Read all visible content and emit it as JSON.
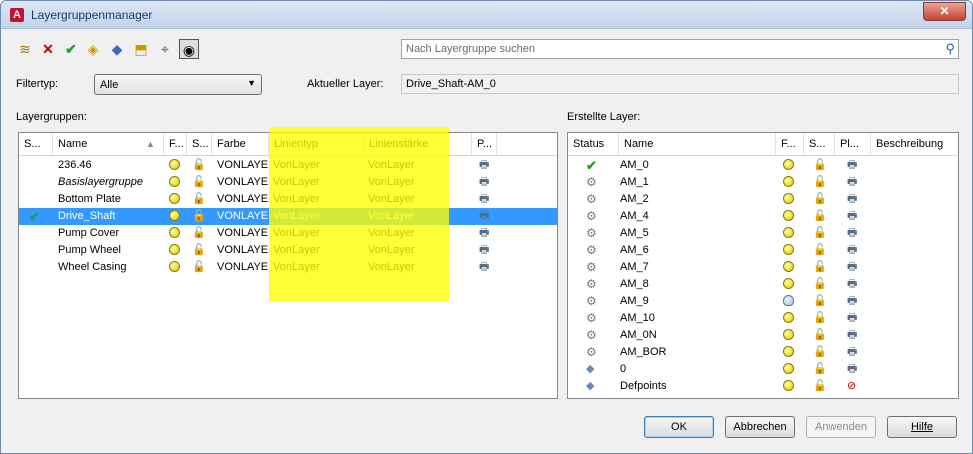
{
  "window": {
    "title": "Layergruppenmanager",
    "close": "✕",
    "app_icon": "A"
  },
  "toolbar": {
    "icons": [
      "new-group-icon",
      "delete-icon",
      "set-current-icon",
      "add-layer-icon",
      "remove-layer-icon",
      "select-object-icon",
      "isolate-icon",
      "visibility-eye-icon"
    ]
  },
  "search": {
    "placeholder": "Nach Layergruppe suchen"
  },
  "filter": {
    "label": "Filtertyp:",
    "value": "Alle"
  },
  "current_layer": {
    "label": "Aktueller Layer:",
    "value": "Drive_Shaft-AM_0"
  },
  "groups_panel": {
    "label": "Layergruppen:",
    "columns": [
      "S...",
      "Name",
      "F...",
      "S...",
      "Farbe",
      "Linientyp",
      "Linienstärke",
      "P..."
    ],
    "rows": [
      {
        "name": "236.46",
        "color": "VONLAYER",
        "linetype": "VonLayer",
        "lineweight": "VonLayer",
        "current": false,
        "italic": false
      },
      {
        "name": "Basislayergruppe",
        "color": "VONLAYER",
        "linetype": "VonLayer",
        "lineweight": "VonLayer",
        "current": false,
        "italic": true
      },
      {
        "name": "Bottom Plate",
        "color": "VONLAYER",
        "linetype": "VonLayer",
        "lineweight": "VonLayer",
        "current": false,
        "italic": false
      },
      {
        "name": "Drive_Shaft",
        "color": "VONLAYER",
        "linetype": "VonLayer",
        "lineweight": "VonLayer",
        "current": true,
        "italic": false
      },
      {
        "name": "Pump Cover",
        "color": "VONLAYER",
        "linetype": "VonLayer",
        "lineweight": "VonLayer",
        "current": false,
        "italic": false
      },
      {
        "name": "Pump Wheel",
        "color": "VONLAYER",
        "linetype": "VonLayer",
        "lineweight": "VonLayer",
        "current": false,
        "italic": false
      },
      {
        "name": "Wheel Casing",
        "color": "VONLAYER",
        "linetype": "VonLayer",
        "lineweight": "VonLayer",
        "current": false,
        "italic": false
      }
    ]
  },
  "layers_panel": {
    "label": "Erstellte Layer:",
    "columns": [
      "Status",
      "Name",
      "F...",
      "S...",
      "Pl...",
      "Beschreibung"
    ],
    "rows": [
      {
        "name": "AM_0",
        "status": "check-icon",
        "on": true,
        "plot": true
      },
      {
        "name": "AM_1",
        "status": "layer-gear-icon",
        "on": true,
        "plot": true
      },
      {
        "name": "AM_2",
        "status": "layer-gear-icon",
        "on": true,
        "plot": true
      },
      {
        "name": "AM_4",
        "status": "layer-gear-icon",
        "on": true,
        "plot": true
      },
      {
        "name": "AM_5",
        "status": "layer-gear-icon",
        "on": true,
        "plot": true
      },
      {
        "name": "AM_6",
        "status": "layer-gear-icon",
        "on": true,
        "plot": true
      },
      {
        "name": "AM_7",
        "status": "layer-gear-icon",
        "on": true,
        "plot": true
      },
      {
        "name": "AM_8",
        "status": "layer-gear-icon",
        "on": true,
        "plot": true
      },
      {
        "name": "AM_9",
        "status": "layer-gear-icon",
        "on": false,
        "plot": true
      },
      {
        "name": "AM_10",
        "status": "layer-gear-icon",
        "on": true,
        "plot": true
      },
      {
        "name": "AM_0N",
        "status": "layer-gear-icon",
        "on": true,
        "plot": true
      },
      {
        "name": "AM_BOR",
        "status": "layer-gear-icon",
        "on": true,
        "plot": true
      },
      {
        "name": "0",
        "status": "layer-plane-icon",
        "on": true,
        "plot": true
      },
      {
        "name": "Defpoints",
        "status": "layer-plane-icon",
        "on": true,
        "plot": false
      }
    ]
  },
  "buttons": {
    "ok": "OK",
    "cancel": "Abbrechen",
    "apply": "Anwenden",
    "help": "Hilfe"
  },
  "colors": {
    "selection": "#3399ff",
    "highlight": "#ffff00",
    "title_text": "#1e395b"
  }
}
